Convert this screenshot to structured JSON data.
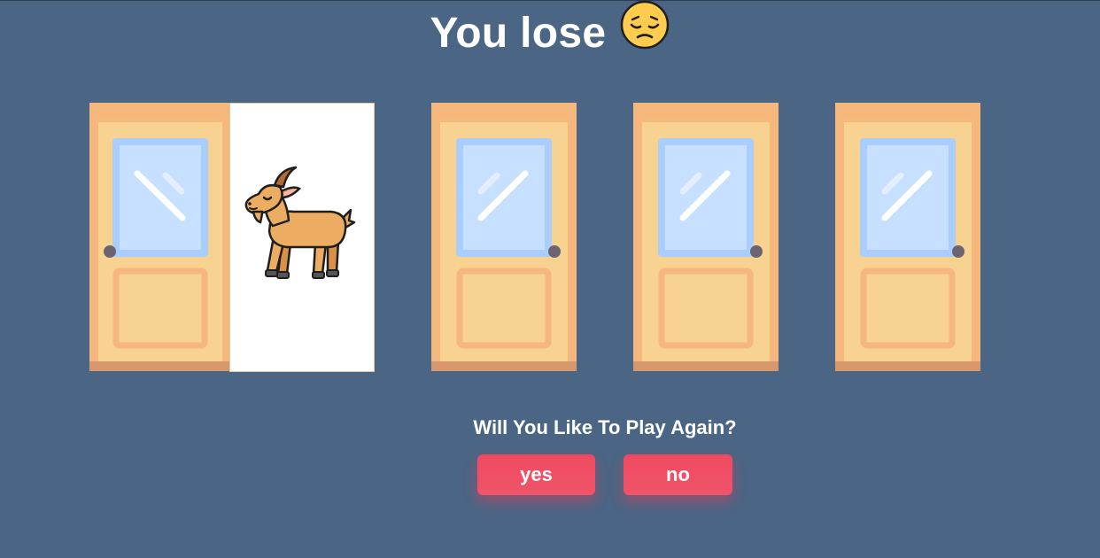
{
  "game": {
    "result_text": "You lose",
    "result_emoji": "disappointed-face-icon",
    "doors": [
      {
        "state": "open",
        "reveal": "goat-icon"
      },
      {
        "state": "closed"
      },
      {
        "state": "closed"
      },
      {
        "state": "closed"
      }
    ]
  },
  "prompt": {
    "question": "Will You Like To Play Again?",
    "yes_label": "yes",
    "no_label": "no"
  },
  "colors": {
    "background": "#4b6584",
    "door_frame": "#f6b77c",
    "door_panel": "#f8d290",
    "glass": "#c7e0ff",
    "button": "#ef4b62"
  }
}
